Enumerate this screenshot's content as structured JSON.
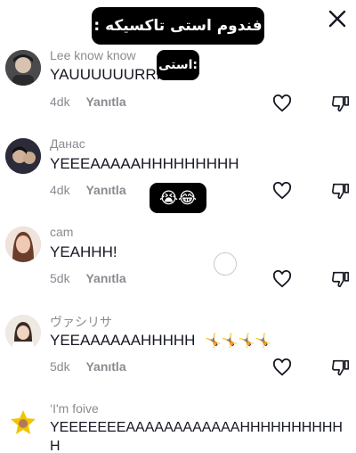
{
  "overlay": {
    "title": "فندوم استی تاکسیکه :",
    "sticker_label": "استی:",
    "emoji_sticker": "😭😂"
  },
  "comments": [
    {
      "username": "Lee know know",
      "text": "YAUUUUUURRR",
      "time": "4dk",
      "reply": "Yanıtla",
      "avatar_color": "#3b3a3c"
    },
    {
      "username": "Данас",
      "text": "YEEEAAAAAHHHHHHHHH",
      "time": "4dk",
      "reply": "Yanıtla",
      "avatar_color": "#222233"
    },
    {
      "username": "cam",
      "text": "YEAHHH!",
      "time": "5dk",
      "reply": "Yanıtla",
      "avatar_color": "#d7b4a8"
    },
    {
      "username": "ヴァシリサ",
      "text": "YEEAAAAAAHHHHH",
      "emojis": "🤸🤸🤸🤸",
      "time": "5dk",
      "reply": "Yanıtla",
      "avatar_color": "#e9e4dc"
    },
    {
      "username": "‘I'm foive",
      "text": "YEEEEEEEAAAAAAAAAAAAHHHHHHHHHH",
      "text2": "H",
      "avatar_color": "#f2c400"
    }
  ],
  "colors": {
    "text": "#161823",
    "secondary": "#8a8b91",
    "overlay": "#000000"
  }
}
